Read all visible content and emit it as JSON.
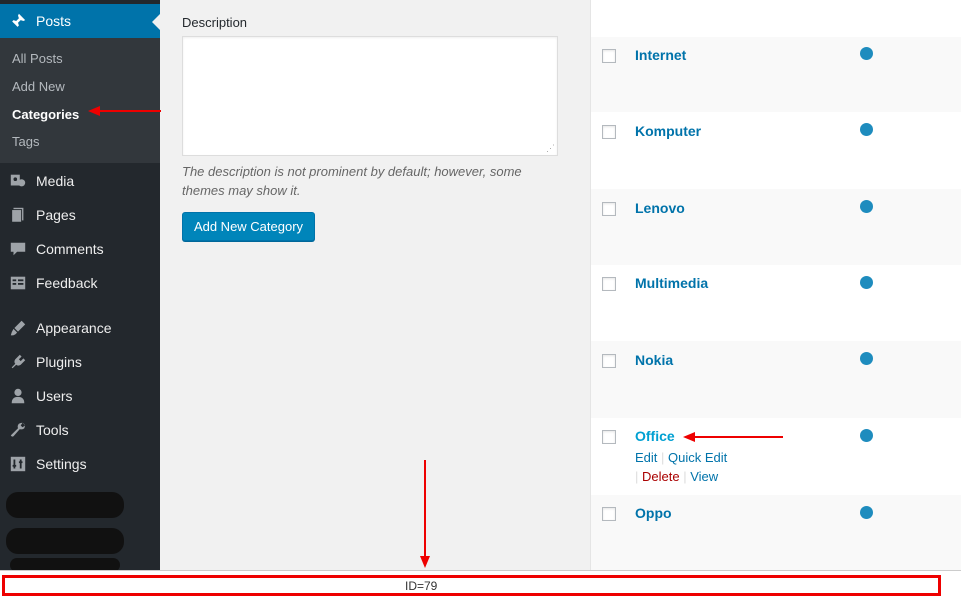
{
  "sidebar": {
    "posts": {
      "label": "Posts",
      "icon": "pushpin-icon"
    },
    "submenu": [
      "All Posts",
      "Add New",
      "Categories",
      "Tags"
    ],
    "items": [
      {
        "label": "Media",
        "icon": "media-icon"
      },
      {
        "label": "Pages",
        "icon": "pages-icon"
      },
      {
        "label": "Comments",
        "icon": "comments-icon"
      },
      {
        "label": "Feedback",
        "icon": "feedback-icon"
      },
      {
        "label": "Appearance",
        "icon": "brush-icon"
      },
      {
        "label": "Plugins",
        "icon": "plugin-icon"
      },
      {
        "label": "Users",
        "icon": "users-icon"
      },
      {
        "label": "Tools",
        "icon": "wrench-icon"
      },
      {
        "label": "Settings",
        "icon": "settings-icon"
      }
    ],
    "accent_color": "#0073aa"
  },
  "form": {
    "description_label": "Description",
    "description_value": "",
    "description_help": "The description is not prominent by default; however, some themes may show it.",
    "submit_label": "Add New Category"
  },
  "categories": {
    "rows": [
      {
        "name": "Internet"
      },
      {
        "name": "Komputer"
      },
      {
        "name": "Lenovo"
      },
      {
        "name": "Multimedia"
      },
      {
        "name": "Nokia"
      },
      {
        "name": "Office"
      },
      {
        "name": "Oppo"
      }
    ],
    "row_actions": {
      "edit": "Edit",
      "quick_edit": "Quick Edit",
      "delete": "Delete",
      "view": "View",
      "separator": "|"
    }
  },
  "statusbar": {
    "text": "ID=79"
  }
}
